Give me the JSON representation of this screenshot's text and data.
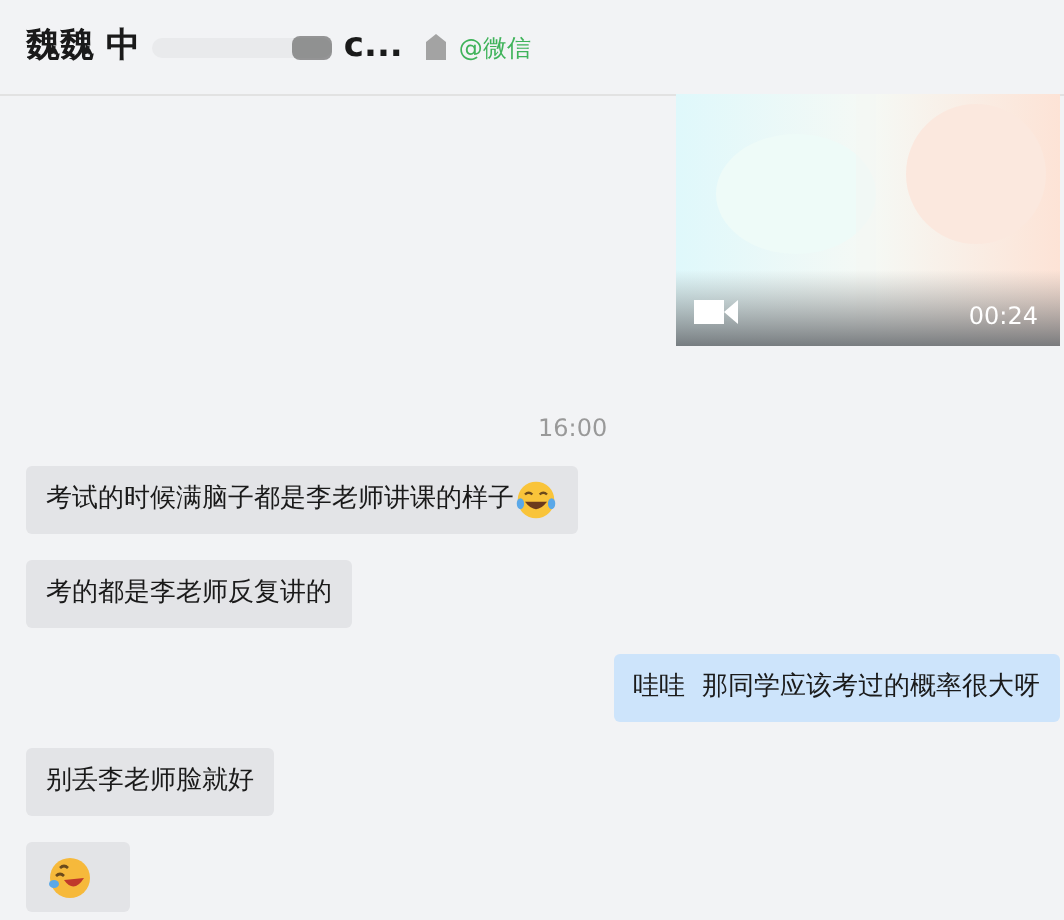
{
  "header": {
    "title_start": "魏魏 中",
    "title_end": "c...",
    "source": "@微信"
  },
  "messages": [
    {
      "kind": "video",
      "outgoing": true,
      "duration": "00:24"
    },
    {
      "kind": "time",
      "text": "16:00"
    },
    {
      "kind": "text_emoji",
      "outgoing": false,
      "text": "考试的时候满脑子都是李老师讲课的样子"
    },
    {
      "kind": "text",
      "outgoing": false,
      "text": "考的都是李老师反复讲的"
    },
    {
      "kind": "text",
      "outgoing": true,
      "text": "哇哇  那同学应该考过的概率很大呀"
    },
    {
      "kind": "text",
      "outgoing": false,
      "text": "别丢李老师脸就好"
    },
    {
      "kind": "sticker",
      "outgoing": false
    }
  ]
}
